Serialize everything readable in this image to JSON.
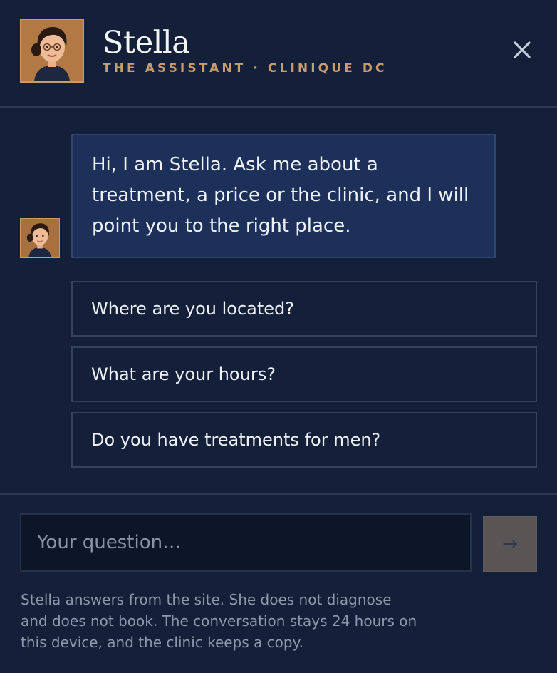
{
  "header": {
    "name": "Stella",
    "subtitle": "THE ASSISTANT · CLINIQUE DC",
    "close_icon": "close-icon"
  },
  "message": {
    "text": "Hi, I am Stella. Ask me about a treatment, a price or the clinic, and I will point you to the right place.",
    "avatar_icon": "assistant-avatar"
  },
  "suggestions": [
    {
      "label": "Where are you located?"
    },
    {
      "label": "What are your hours?"
    },
    {
      "label": "Do you have treatments for men?"
    }
  ],
  "composer": {
    "placeholder": "Your question…",
    "send_label": "→"
  },
  "disclaimer": "Stella answers from the site. She does not diagnose and does not book. The conversation stays 24 hours on this device, and the clinic keeps a copy.",
  "colors": {
    "background": "#14203a",
    "accent_gold": "#c99c6c",
    "bubble": "#1c305a",
    "send_button": "#5a5454"
  }
}
